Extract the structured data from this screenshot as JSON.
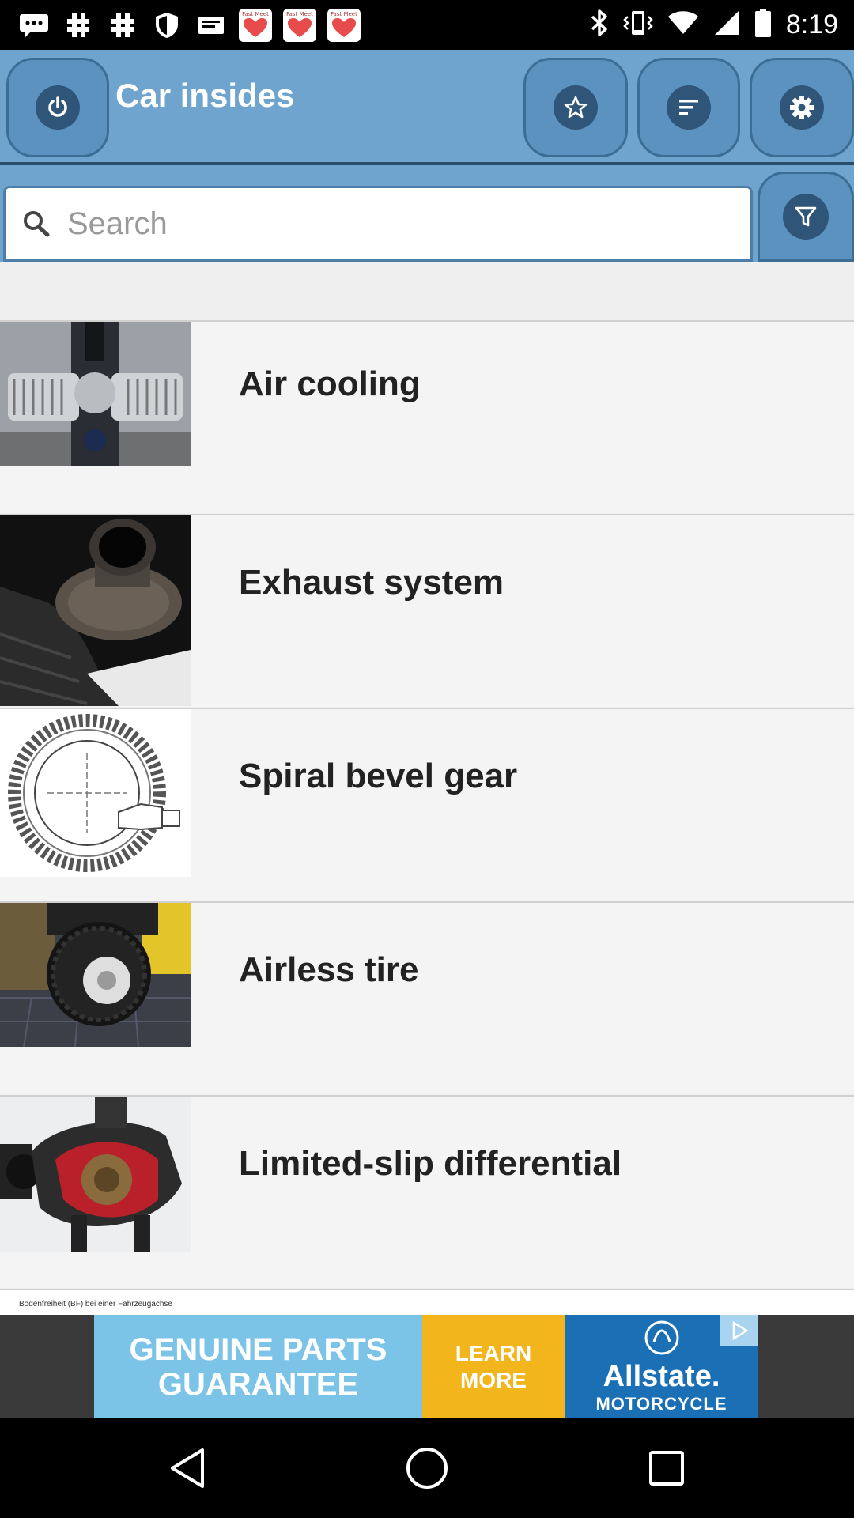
{
  "status_bar": {
    "time": "8:19",
    "notification_icons": [
      "message-icon",
      "hashtag-icon",
      "hashtag-icon",
      "shield-icon",
      "slides-icon",
      "fast-meet-app-icon",
      "fast-meet-app-icon",
      "fast-meet-app-icon"
    ],
    "app_tile_label": "Fast Meet",
    "system_icons": [
      "bluetooth-icon",
      "vibrate-icon",
      "wifi-icon",
      "signal-icon",
      "battery-icon"
    ]
  },
  "header": {
    "title": "Car insides",
    "buttons": [
      "power-icon",
      "star-icon",
      "sort-icon",
      "gear-icon"
    ],
    "color": "#6fa4cf"
  },
  "search": {
    "placeholder": "Search",
    "value": ""
  },
  "list": {
    "items": [
      {
        "label": "Air cooling",
        "thumb": "engine-photo"
      },
      {
        "label": "Exhaust system",
        "thumb": "exhaust-photo"
      },
      {
        "label": "Spiral bevel gear",
        "thumb": "bevel-gear-drawing"
      },
      {
        "label": "Airless tire",
        "thumb": "forklift-tire-photo"
      },
      {
        "label": "Limited-slip differential",
        "thumb": "differential-photo"
      }
    ],
    "next_item_caption": "Bodenfreiheit (BF) bei einer Fahrzeugachse"
  },
  "ad": {
    "headline_line1": "GENUINE PARTS",
    "headline_line2": "GUARANTEE",
    "cta_line1": "LEARN",
    "cta_line2": "MORE",
    "brand": "Allstate.",
    "brand_sub": "MOTORCYCLE"
  },
  "nav": {
    "buttons": [
      "back-icon",
      "home-icon",
      "recents-icon"
    ]
  }
}
